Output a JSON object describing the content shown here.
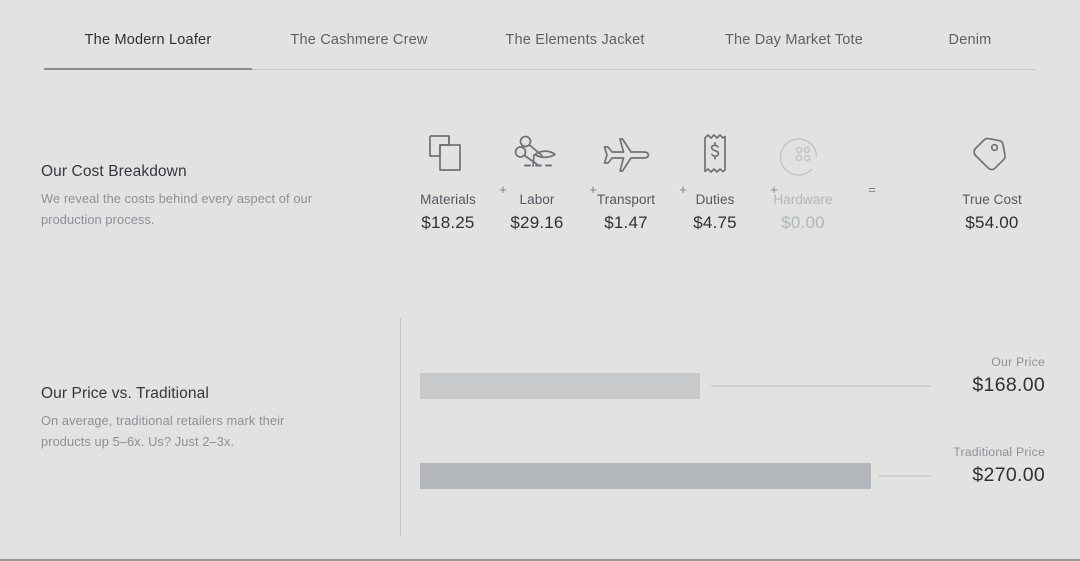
{
  "tabs": [
    {
      "label": "The Modern Loafer",
      "active": true
    },
    {
      "label": "The Cashmere Crew",
      "active": false
    },
    {
      "label": "The Elements Jacket",
      "active": false
    },
    {
      "label": "The Day Market Tote",
      "active": false
    },
    {
      "label": "Denim",
      "active": false
    }
  ],
  "cost_section": {
    "title": "Our Cost Breakdown",
    "description": "We reveal the costs behind every aspect of our production process.",
    "items": [
      {
        "name": "Materials",
        "value": "$18.25",
        "icon": "fabric-swatches-icon",
        "muted": false
      },
      {
        "name": "Labor",
        "value": "$29.16",
        "icon": "scissors-icon",
        "muted": false
      },
      {
        "name": "Transport",
        "value": "$1.47",
        "icon": "airplane-icon",
        "muted": false
      },
      {
        "name": "Duties",
        "value": "$4.75",
        "icon": "receipt-dollar-icon",
        "muted": false
      },
      {
        "name": "Hardware",
        "value": "$0.00",
        "icon": "button-icon",
        "muted": true
      }
    ],
    "operators": [
      "+",
      "+",
      "+",
      "+",
      "="
    ],
    "total": {
      "name": "True Cost",
      "value": "$54.00",
      "icon": "price-tag-icon"
    }
  },
  "price_section": {
    "title": "Our Price vs. Traditional",
    "description": "On average, traditional retailers mark their products up 5–6x. Us? Just 2–3x.",
    "bars": [
      {
        "caption": "Our Price",
        "amount": "$168.00",
        "fill": "#c8c9ca"
      },
      {
        "caption": "Traditional Price",
        "amount": "$270.00",
        "fill": "#b3b7bb"
      }
    ]
  },
  "chart_data": {
    "type": "bar",
    "title": "Our Price vs. Traditional",
    "categories": [
      "Our Price",
      "Traditional Price"
    ],
    "values": [
      168.0,
      270.0
    ],
    "value_labels": [
      "$168.00",
      "$270.00"
    ],
    "xlabel": "",
    "ylabel": "",
    "orientation": "horizontal",
    "grid": false,
    "legend": "none"
  },
  "colors": {
    "background": "#e2e2e2",
    "text_primary": "#2e3134",
    "text_secondary": "#8c9094",
    "bar_our": "#c8c9ca",
    "bar_traditional": "#b3b7bb",
    "divider": "#c9c9c9",
    "tab_underline": "#8a8d8f"
  }
}
